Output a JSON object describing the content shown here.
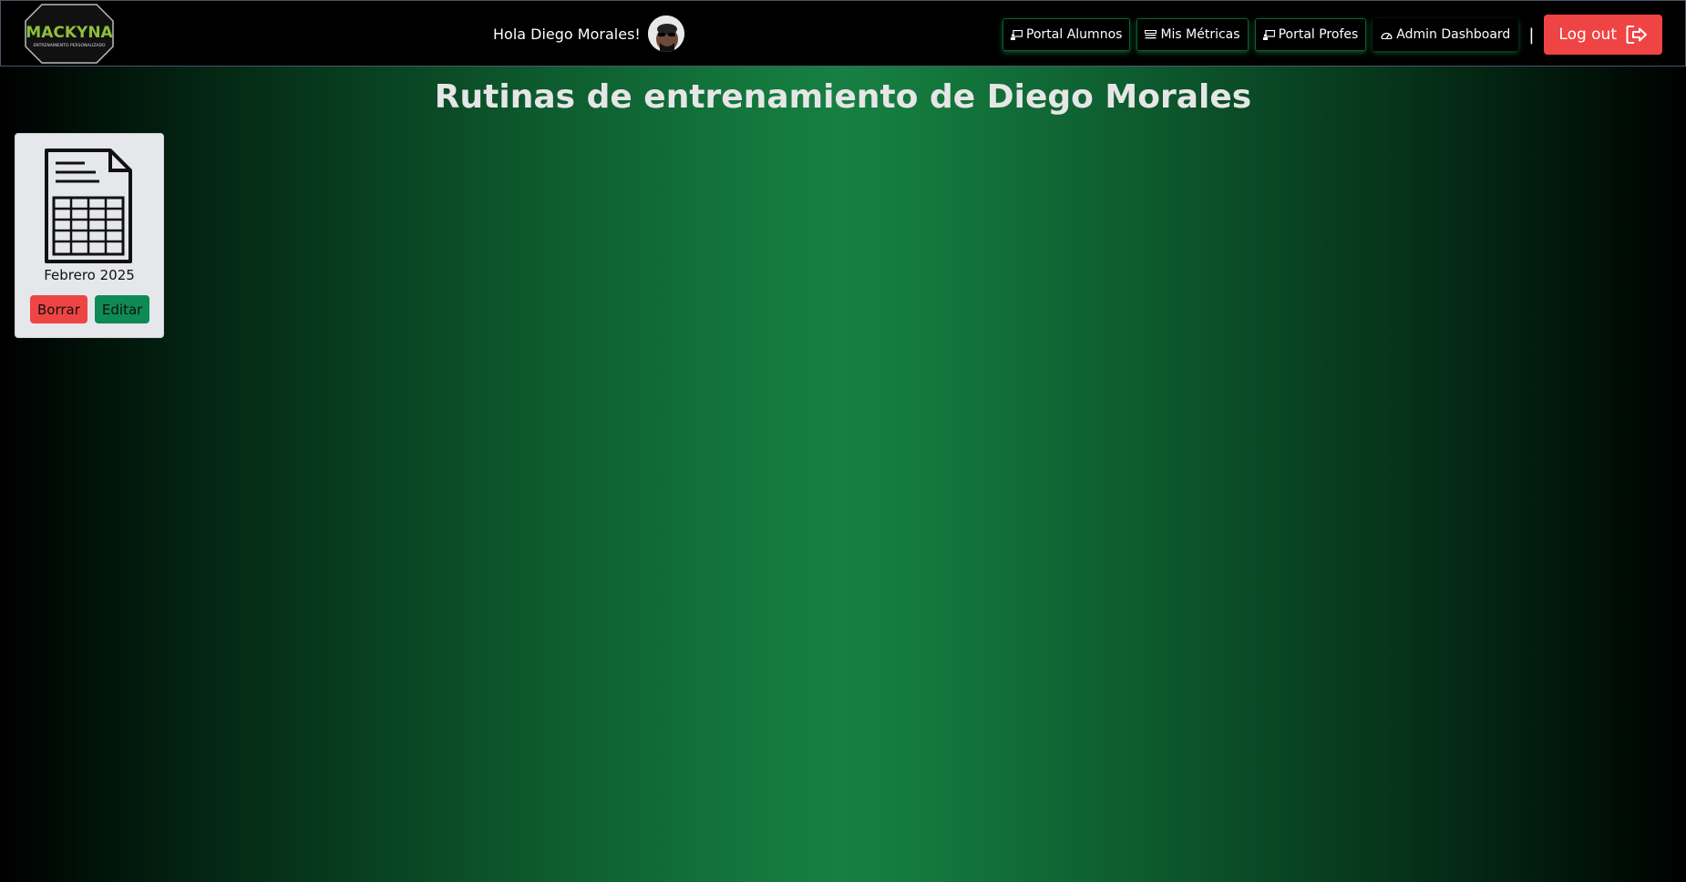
{
  "navbar": {
    "logo_text": "MACKYNA",
    "logo_subtext": "ENTRENAMIENTO PERSONALIZADO",
    "greeting": "Hola Diego Morales!",
    "links": [
      {
        "label": "Portal Alumnos",
        "icon": "chalkboard-user-icon"
      },
      {
        "label": "Mis Métricas",
        "icon": "list-icon"
      },
      {
        "label": "Portal Profes",
        "icon": "chalkboard-user-icon"
      },
      {
        "label": "Admin Dashboard",
        "icon": "gauge-icon"
      }
    ],
    "separator": "|",
    "logout_label": "Log out"
  },
  "main": {
    "title": "Rutinas de entrenamiento de Diego Morales",
    "routines": [
      {
        "label": "Febrero 2025",
        "icon": "spreadsheet-document-icon",
        "delete_label": "Borrar",
        "edit_label": "Editar"
      }
    ]
  },
  "colors": {
    "accent_green": "#177f41",
    "danger_red": "#ef4444",
    "edit_green": "#0e8a55"
  }
}
